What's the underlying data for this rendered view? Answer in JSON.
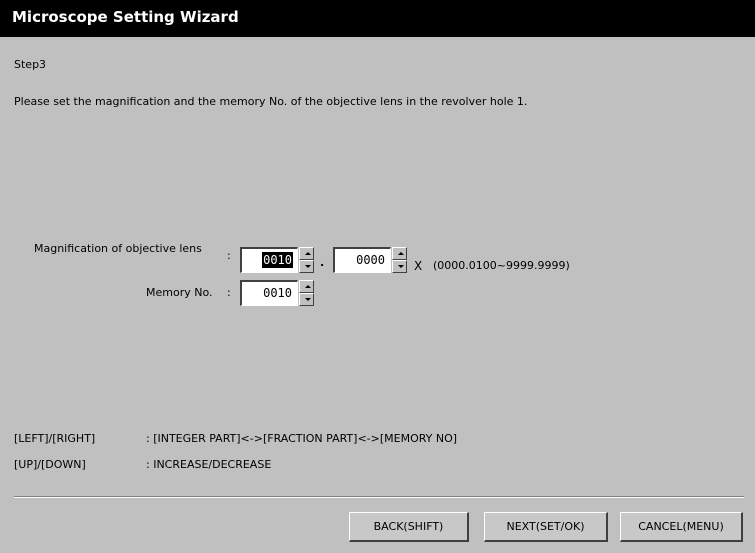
{
  "window": {
    "title": "Microscope Setting Wizard"
  },
  "step": "Step3",
  "instruction": "Please set the magnification and the memory No. of the objective lens in the revolver hole 1.",
  "magnification": {
    "label": "Magnification of objective lens",
    "colon": ":",
    "integer_value": "0010",
    "decimal_point": ".",
    "fraction_value": "0000",
    "unit": "X",
    "range": "(0000.0100~9999.9999)"
  },
  "memory": {
    "label": "Memory No.",
    "colon": ":",
    "value": "0010"
  },
  "help": [
    {
      "keys": "[LEFT]/[RIGHT]",
      "desc": ": [INTEGER PART]<->[FRACTION PART]<->[MEMORY NO]"
    },
    {
      "keys": "[UP]/[DOWN]",
      "desc": ": INCREASE/DECREASE"
    }
  ],
  "buttons": {
    "back": "BACK(SHIFT)",
    "next": "NEXT(SET/OK)",
    "cancel": "CANCEL(MENU)"
  }
}
